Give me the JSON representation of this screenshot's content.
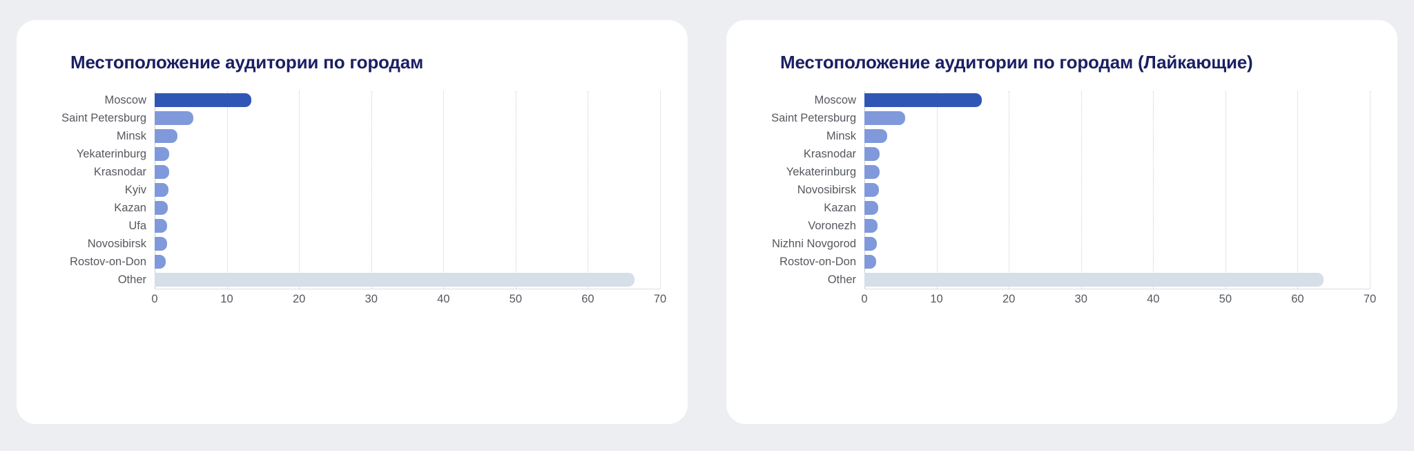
{
  "page": {
    "background_color": "#eceef2"
  },
  "colors": {
    "title": "#1b1f63",
    "bar_primary": "#3056b5",
    "bar_secondary": "#8099db",
    "bar_other": "#d6dee8",
    "axis_text": "#55585e",
    "gridline": "#c9ccd2",
    "card_background": "#ffffff"
  },
  "charts": [
    {
      "title": "Местоположение аудитории по городам"
    },
    {
      "title": "Местоположение аудитории по городам (Лайкающие)"
    }
  ],
  "chart_data": [
    {
      "type": "bar",
      "orientation": "horizontal",
      "title": "Местоположение аудитории по городам",
      "xlabel": "",
      "ylabel": "",
      "xlim": [
        0,
        70
      ],
      "xticks": [
        0,
        10,
        20,
        30,
        40,
        50,
        60,
        70
      ],
      "grid": true,
      "legend": "none",
      "categories": [
        "Moscow",
        "Saint Petersburg",
        "Minsk",
        "Yekaterinburg",
        "Krasnodar",
        "Kyiv",
        "Kazan",
        "Ufa",
        "Novosibirsk",
        "Rostov-on-Don",
        "Other"
      ],
      "values": [
        13.4,
        5.4,
        3.2,
        2.0,
        2.0,
        1.9,
        1.8,
        1.7,
        1.7,
        1.5,
        66.5
      ],
      "bar_styles": [
        "primary",
        "secondary",
        "secondary",
        "secondary",
        "secondary",
        "secondary",
        "secondary",
        "secondary",
        "secondary",
        "secondary",
        "other"
      ]
    },
    {
      "type": "bar",
      "orientation": "horizontal",
      "title": "Местоположение аудитории по городам (Лайкающие)",
      "xlabel": "",
      "ylabel": "",
      "xlim": [
        0,
        70
      ],
      "xticks": [
        0,
        10,
        20,
        30,
        40,
        50,
        60,
        70
      ],
      "grid": true,
      "legend": "none",
      "categories": [
        "Moscow",
        "Saint Petersburg",
        "Minsk",
        "Krasnodar",
        "Yekaterinburg",
        "Novosibirsk",
        "Kazan",
        "Voronezh",
        "Nizhni Novgorod",
        "Rostov-on-Don",
        "Other"
      ],
      "values": [
        16.3,
        5.6,
        3.2,
        2.1,
        2.1,
        2.0,
        1.9,
        1.8,
        1.7,
        1.6,
        63.6
      ],
      "bar_styles": [
        "primary",
        "secondary",
        "secondary",
        "secondary",
        "secondary",
        "secondary",
        "secondary",
        "secondary",
        "secondary",
        "secondary",
        "other"
      ]
    }
  ]
}
